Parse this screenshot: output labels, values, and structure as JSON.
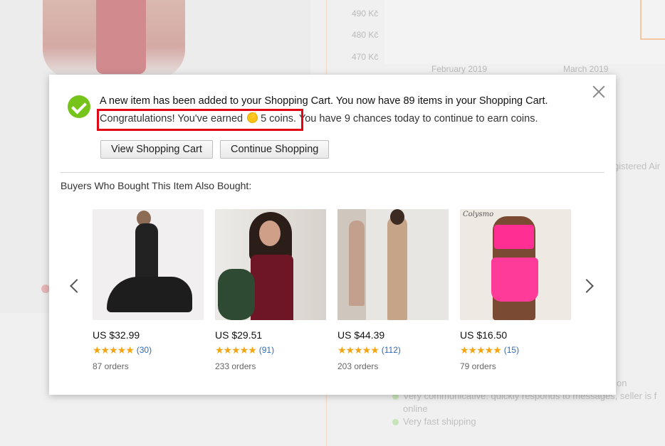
{
  "background": {
    "chart": {
      "y_ticks": [
        "490 Kč",
        "480 Kč",
        "470 Kč"
      ],
      "x_ticks": [
        "February 2019",
        "March 2019"
      ]
    },
    "fragments": {
      "registered": "gistered Air",
      "on": "on",
      "communicative": "Very communicative: quickly responds to messages, seller is f",
      "online": "online",
      "shipping": "Very fast shipping"
    }
  },
  "modal": {
    "message": "A new item has been added to your Shopping Cart. You now have 89 items in your Shopping Cart.",
    "coins": {
      "prefix": "Congratulations! You've earned",
      "amount_text": "5 coins.",
      "suffix": "You have 9 chances today to continue to earn coins."
    },
    "buttons": {
      "view_cart": "View Shopping Cart",
      "continue": "Continue Shopping"
    },
    "section_title": "Buyers Who Bought This Item Also Bought:",
    "products": [
      {
        "price": "US $32.99",
        "rating_stars": "★★★★★",
        "reviews": "(30)",
        "orders": "87 orders"
      },
      {
        "price": "US $29.51",
        "rating_stars": "★★★★★",
        "reviews": "(91)",
        "orders": "233 orders"
      },
      {
        "price": "US $44.39",
        "rating_stars": "★★★★★",
        "reviews": "(112)",
        "orders": "203 orders"
      },
      {
        "price": "US $16.50",
        "rating_stars": "★★★★★",
        "reviews": "(15)",
        "orders": "79 orders"
      }
    ],
    "product4_logo": "Colysmo"
  },
  "colors": {
    "success_green": "#76c41a",
    "highlight_red": "#e10613",
    "star_orange": "#f4a514",
    "link_blue": "#2a6cbc"
  }
}
